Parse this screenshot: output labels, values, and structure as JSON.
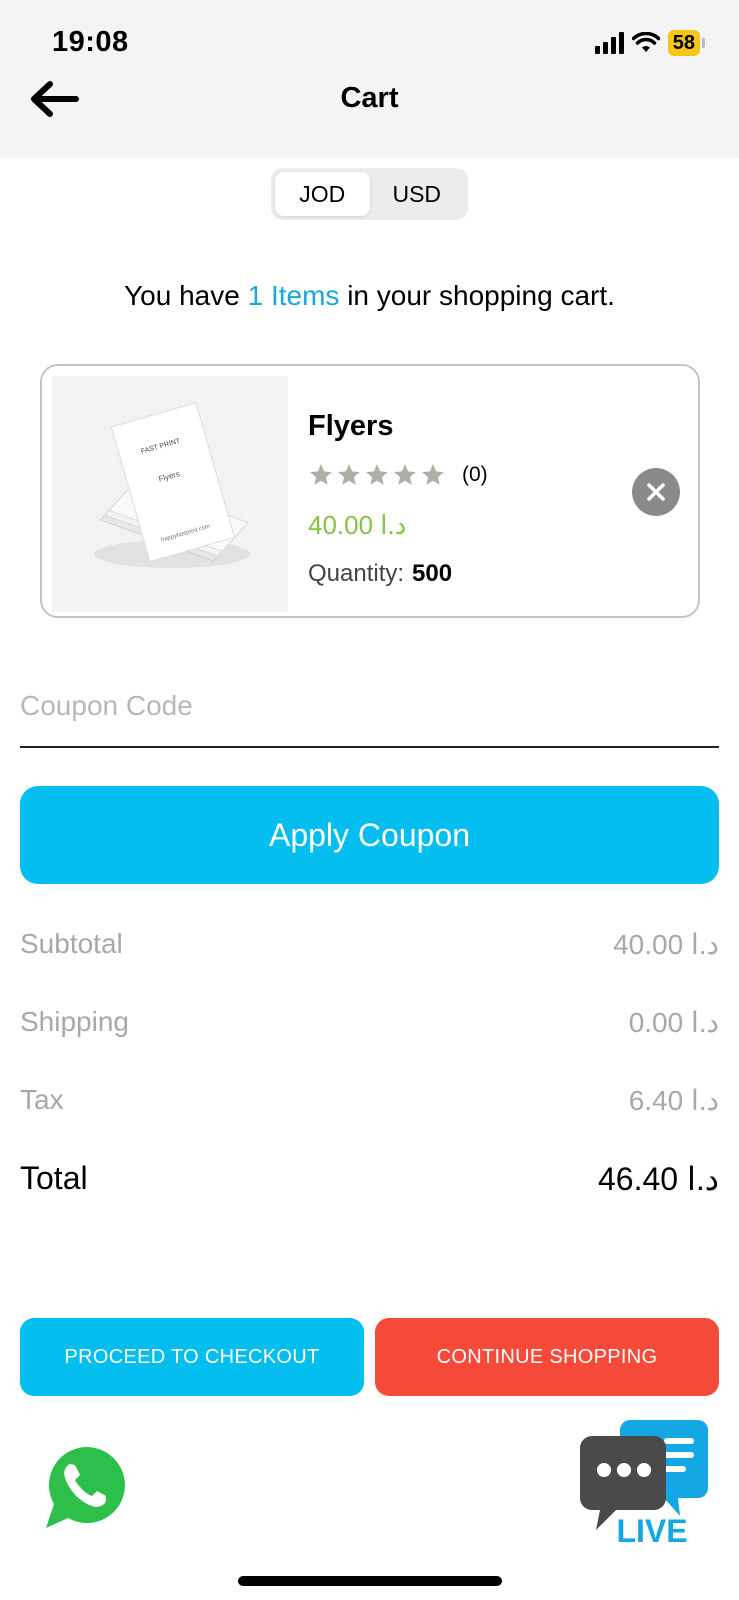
{
  "status_bar": {
    "time": "19:08",
    "battery": "58"
  },
  "header": {
    "title": "Cart"
  },
  "currency": {
    "options": [
      "JOD",
      "USD"
    ],
    "selected": "JOD"
  },
  "cart_summary": {
    "prefix": "You have ",
    "count_text": "1 Items",
    "suffix": " in your shopping cart."
  },
  "items": [
    {
      "name": "Flyers",
      "rating_count": "(0)",
      "rating": 0,
      "price": "40.00 د.ا",
      "quantity_label": "Quantity:",
      "quantity": "500",
      "image_text": {
        "brand": "FAST PRINT",
        "label": "Flyers",
        "url": "happyfastprint.com"
      }
    }
  ],
  "coupon": {
    "placeholder": "Coupon Code",
    "value": "",
    "apply_label": "Apply Coupon"
  },
  "totals": {
    "subtotal_label": "Subtotal",
    "subtotal": "40.00 د.ا",
    "shipping_label": "Shipping",
    "shipping": "0.00 د.ا",
    "tax_label": "Tax",
    "tax": "6.40 د.ا",
    "total_label": "Total",
    "total": "46.40 د.ا"
  },
  "actions": {
    "checkout_label": "PROCEED TO CHECKOUT",
    "continue_label": "CONTINUE SHOPPING"
  },
  "floating": {
    "live_label": "LIVE"
  },
  "colors": {
    "accent": "#04bef0",
    "danger": "#f54a39",
    "price_green": "#86c444",
    "link_blue": "#17a9de"
  },
  "icons": [
    "back-arrow-icon",
    "signal-icon",
    "wifi-icon",
    "battery-icon",
    "star-icon",
    "close-icon",
    "whatsapp-icon",
    "live-chat-icon"
  ]
}
